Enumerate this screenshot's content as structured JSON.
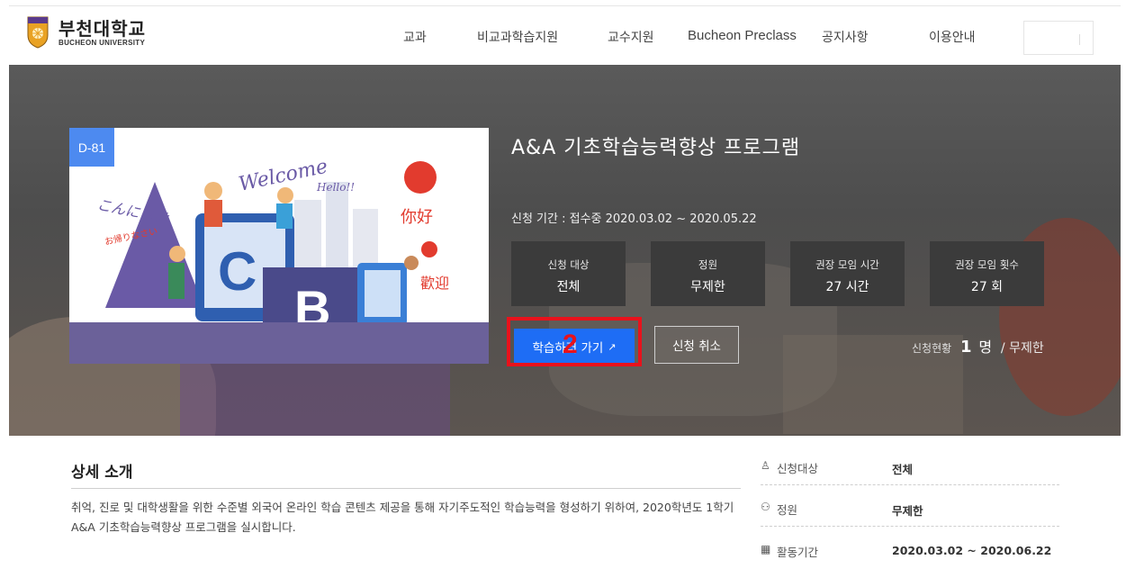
{
  "header": {
    "logo_ko": "부천대학교",
    "logo_en": "BUCHEON UNIVERSITY",
    "nav": [
      "교과",
      "비교과학습지원",
      "교수지원",
      "Bucheon Preclass",
      "공지사항",
      "이용안내"
    ]
  },
  "program": {
    "dday": "D-81",
    "title": "A&A 기초학습능력향상 프로그램",
    "period": "신청 기간 : 접수중 2020.03.02 ~ 2020.05.22",
    "stats": [
      {
        "label": "신청 대상",
        "value": "전체"
      },
      {
        "label": "정원",
        "value": "무제한"
      },
      {
        "label": "권장 모임 시간",
        "value": "27 시간"
      },
      {
        "label": "권장 모임 횟수",
        "value": "27 회"
      }
    ],
    "study_button": "학습하러 가기",
    "annotation_number": "2",
    "cancel_button": "신청 취소",
    "status_label": "신청현황",
    "status_count": "1",
    "status_unit": "명",
    "status_capacity": "/ 무제한"
  },
  "detail": {
    "heading": "상세 소개",
    "description": "취억, 진로 및 대학생활을 위한 수준별 외국어 온라인 학습 콘텐츠 제공을 통해 자기주도적인 학습능력을 형성하기 위하여, 2020학년도 1학기 A&A 기초학습능력향상 프로그램을 실시합니다.",
    "info": [
      {
        "icon": "person-icon",
        "key": "신청대상",
        "value": "전체"
      },
      {
        "icon": "people-icon",
        "key": "정원",
        "value": "무제한"
      },
      {
        "icon": "calendar-icon",
        "key": "활동기간",
        "value": "2020.03.02 ~ 2020.06.22"
      }
    ]
  },
  "colors": {
    "primary_button": "#1e6df5",
    "dday_badge": "#4d8af0",
    "highlight_box": "#e8121c"
  }
}
